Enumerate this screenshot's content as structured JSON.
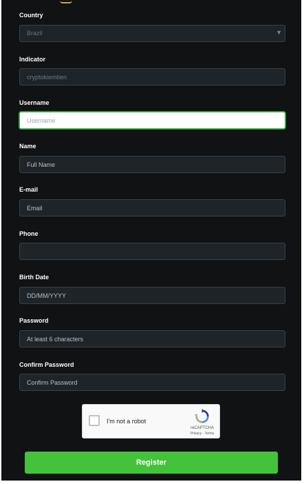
{
  "form": {
    "country": {
      "label": "Country",
      "value": "Brazil"
    },
    "indicator": {
      "label": "Indicator",
      "placeholder": "cryptokiemtien"
    },
    "username": {
      "label": "Username",
      "placeholder": "Username"
    },
    "name": {
      "label": "Name",
      "placeholder": "Full Name"
    },
    "email": {
      "label": "E-mail",
      "placeholder": "Email"
    },
    "phone": {
      "label": "Phone",
      "placeholder": ""
    },
    "birth_date": {
      "label": "Birth Date",
      "placeholder": "DD/MM/YYYY"
    },
    "password": {
      "label": "Password",
      "placeholder": "At least 6 characters"
    },
    "confirm_password": {
      "label": "Confirm Password",
      "placeholder": "Confirm Password"
    }
  },
  "captcha": {
    "checkbox_label": "I'm not a robot",
    "brand": "reCAPTCHA",
    "links": "Privacy - Terms"
  },
  "register_label": "Register",
  "icons": {
    "select_arrow": "chevron-down-icon",
    "captcha_logo": "recaptcha-icon"
  },
  "colors": {
    "background": "#101213",
    "field": "#1f2428",
    "accent_green": "#43c339",
    "focus_border": "#38b64a"
  }
}
